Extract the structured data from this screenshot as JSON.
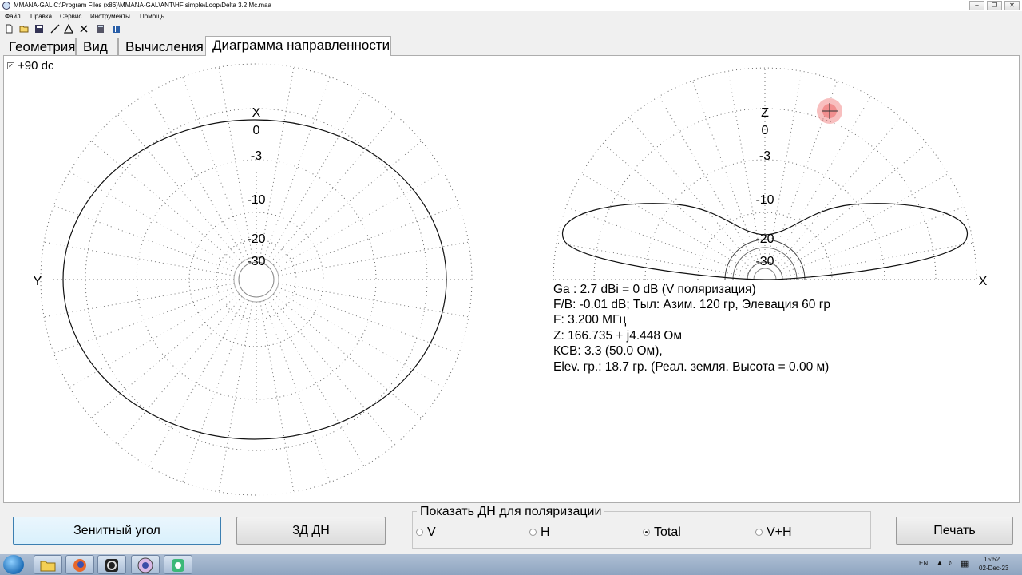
{
  "window": {
    "title": "MMANA-GAL C:\\Program Files (x86)\\MMANA-GAL\\ANT\\HF simple\\Loop\\Delta 3.2 Mc.maa",
    "controls": [
      "‒",
      "❐",
      "✕"
    ]
  },
  "menu": [
    "Файл",
    "Правка",
    "Сервис",
    "Инструменты",
    "Помощь"
  ],
  "toolbar_icons": [
    "new-file-icon",
    "open-folder-icon",
    "save-icon",
    "wire-icon",
    "triangle-icon",
    "tools-icon",
    "calculator-icon",
    "book-icon"
  ],
  "tabs": [
    {
      "label": "Геометрия"
    },
    {
      "label": "Вид"
    },
    {
      "label": "Вычисления"
    },
    {
      "label": "Диаграмма направленности",
      "active": true
    }
  ],
  "options": {
    "plus90_label": "+90 dc",
    "plus90_checked": true
  },
  "plots": {
    "azimuth": {
      "axis_top": "X",
      "axis_left": "Y"
    },
    "elevation": {
      "axis_top": "Z",
      "axis_right": "X"
    },
    "scale_labels": [
      "0",
      "-3",
      "-10",
      "-20",
      "-30"
    ]
  },
  "info": {
    "gain": "Ga : 2.7 dBi = 0 dB  (V поляризация)",
    "fb": "F/B: -0.01 dB; Тыл: Азим. 120 гр, Элевация 60 гр",
    "freq": "F: 3.200 МГц",
    "impedance": "Z: 166.735 + j4.448 Ом",
    "swr": "КСВ: 3.3 (50.0 Ом),",
    "elev": "Elev. гр.: 18.7 гр. (Реал. земля. Высота = 0.00 м)"
  },
  "buttons": {
    "zenith": "Зенитный угол",
    "three_d": "3Д   ДН",
    "print": "Печать"
  },
  "polarization": {
    "title": "Показать ДН для поляризации",
    "options": [
      {
        "label": "V",
        "selected": false
      },
      {
        "label": "H",
        "selected": false
      },
      {
        "label": "Total",
        "selected": true
      },
      {
        "label": "V+H",
        "selected": false
      }
    ]
  },
  "taskbar": {
    "apps": [
      "explorer",
      "firefox",
      "camera",
      "mmana",
      "app"
    ],
    "lang": "EN",
    "time": "15:52",
    "date": "02-Dec-23"
  }
}
